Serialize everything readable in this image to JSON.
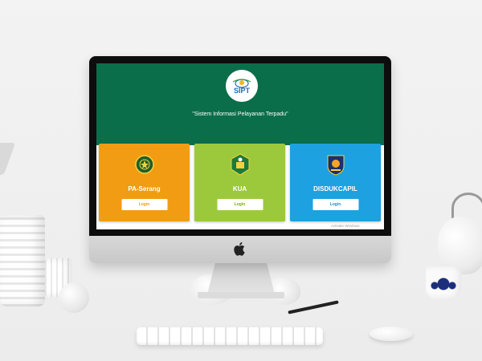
{
  "app": {
    "logo_text": "SIPT",
    "tagline": "\"Sistem Informasi Pelayanan Terpadu\""
  },
  "cards": [
    {
      "title": "PA-Serang",
      "button_label": "Login",
      "color": "#f29c13",
      "icon": "pengadilan-agama-emblem-icon"
    },
    {
      "title": "KUA",
      "button_label": "Login",
      "color": "#9cc93b",
      "icon": "kemenag-emblem-icon"
    },
    {
      "title": "DISDUKCAPIL",
      "button_label": "Login",
      "color": "#1ea1e1",
      "icon": "kemendagri-emblem-icon"
    }
  ],
  "watermark": "Activate Windows",
  "colors": {
    "header_bg": "#0b6e4b",
    "screen_bg": "#ffffff"
  }
}
